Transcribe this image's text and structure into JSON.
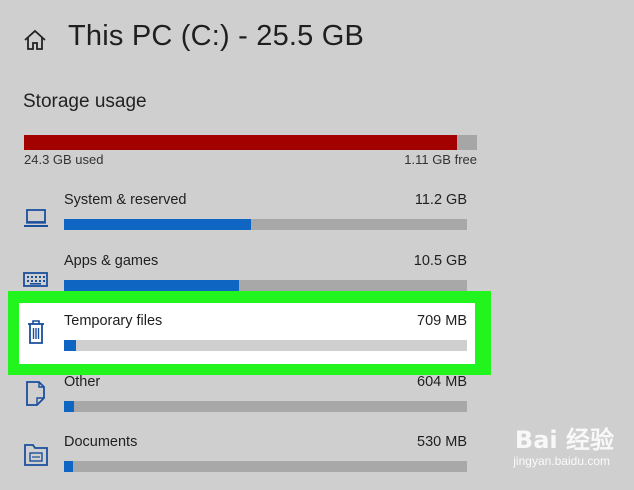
{
  "header": {
    "title": "This PC (C:) - 25.5 GB"
  },
  "storage": {
    "section_title": "Storage usage",
    "used_label": "24.3 GB used",
    "free_label": "1.11 GB free",
    "used_fraction": 0.955,
    "used_color": "#a30000",
    "track_color": "#a6a6a6"
  },
  "categories": [
    {
      "label": "System & reserved",
      "size": "11.2 GB",
      "fraction": 0.464,
      "icon": "laptop-icon"
    },
    {
      "label": "Apps & games",
      "size": "10.5 GB",
      "fraction": 0.434,
      "icon": "keyboard-icon"
    },
    {
      "label": "Temporary files",
      "size": "709 MB",
      "fraction": 0.029,
      "icon": "trash-icon",
      "highlighted": true
    },
    {
      "label": "Other",
      "size": "604 MB",
      "fraction": 0.025,
      "icon": "document-icon"
    },
    {
      "label": "Documents",
      "size": "530 MB",
      "fraction": 0.022,
      "icon": "folder-icon"
    }
  ],
  "colors": {
    "bar_fill": "#0f66c2",
    "highlight": "#22f51e"
  },
  "watermark": {
    "logo": "Bai 经验",
    "sub": "jingyan.baidu.com"
  }
}
